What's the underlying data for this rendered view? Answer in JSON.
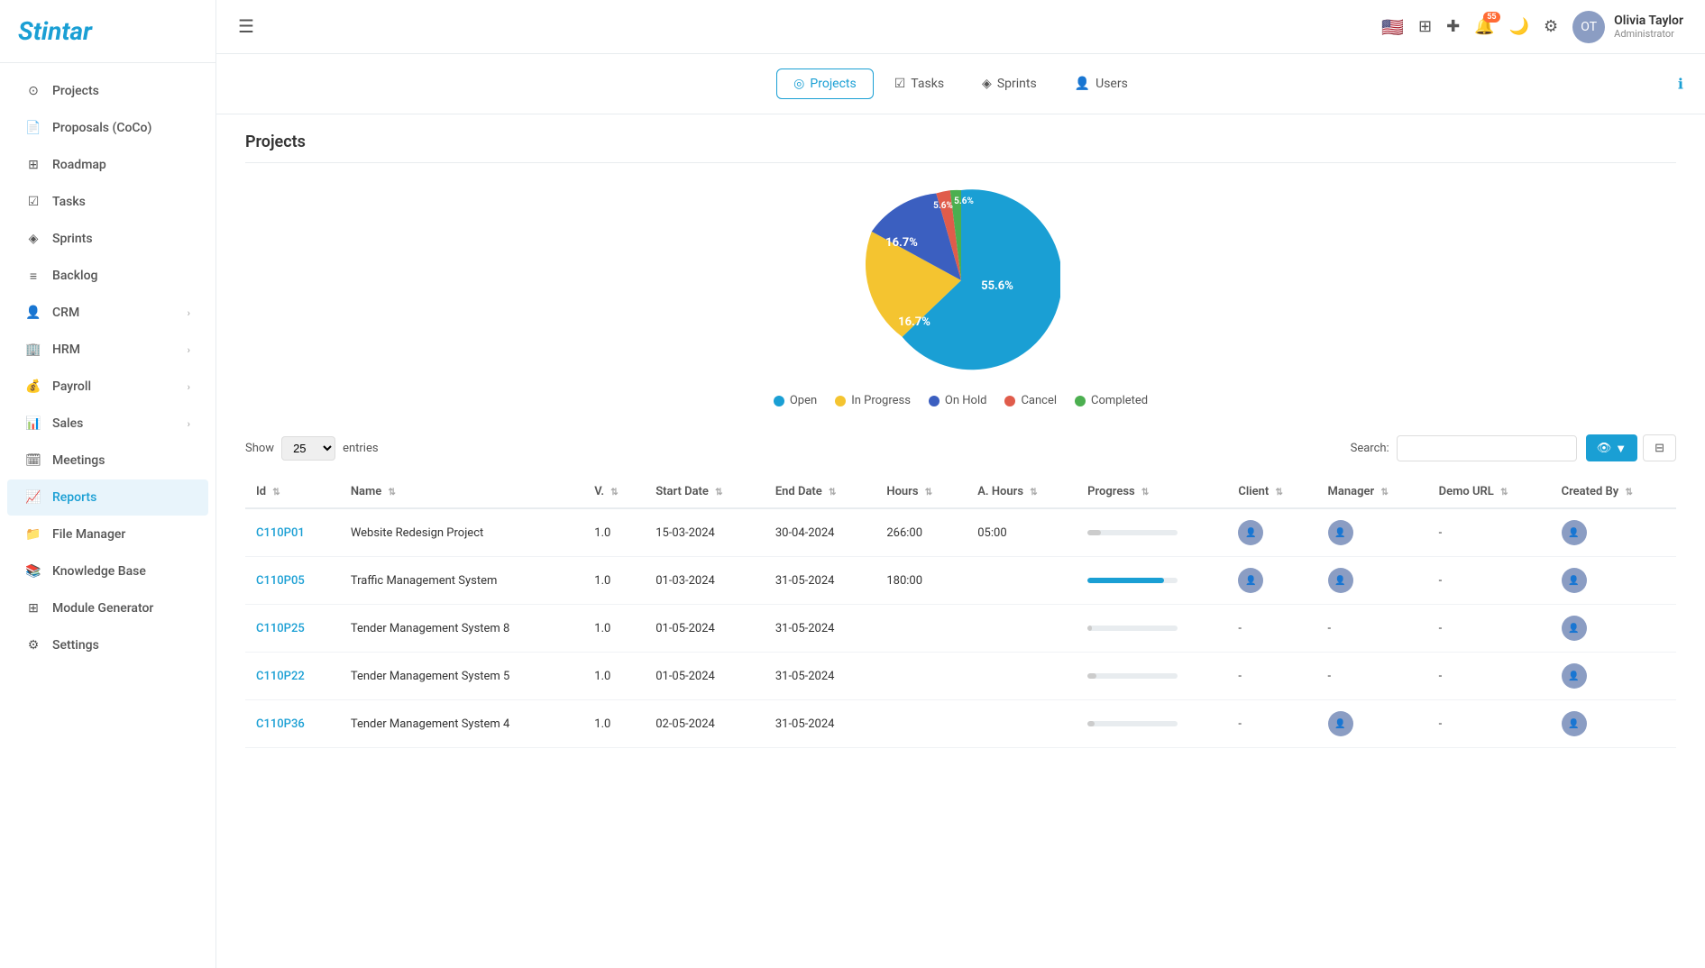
{
  "app": {
    "name": "Stintar",
    "logo_letter": "S"
  },
  "header": {
    "menu_icon": "☰",
    "notification_count": "55",
    "user": {
      "name": "Olivia Taylor",
      "role": "Administrator",
      "initials": "OT"
    }
  },
  "sidebar": {
    "items": [
      {
        "id": "projects",
        "label": "Projects",
        "icon": "◯",
        "active": false,
        "has_arrow": false
      },
      {
        "id": "proposals",
        "label": "Proposals (CoCo)",
        "icon": "📄",
        "active": false,
        "has_arrow": false
      },
      {
        "id": "roadmap",
        "label": "Roadmap",
        "icon": "⊞",
        "active": false,
        "has_arrow": false
      },
      {
        "id": "tasks",
        "label": "Tasks",
        "icon": "☑",
        "active": false,
        "has_arrow": false
      },
      {
        "id": "sprints",
        "label": "Sprints",
        "icon": "◈",
        "active": false,
        "has_arrow": false
      },
      {
        "id": "backlog",
        "label": "Backlog",
        "icon": "≡",
        "active": false,
        "has_arrow": false
      },
      {
        "id": "crm",
        "label": "CRM",
        "icon": "👤",
        "active": false,
        "has_arrow": true
      },
      {
        "id": "hrm",
        "label": "HRM",
        "icon": "🏢",
        "active": false,
        "has_arrow": true
      },
      {
        "id": "payroll",
        "label": "Payroll",
        "icon": "💰",
        "active": false,
        "has_arrow": true
      },
      {
        "id": "sales",
        "label": "Sales",
        "icon": "📊",
        "active": false,
        "has_arrow": true
      },
      {
        "id": "meetings",
        "label": "Meetings",
        "icon": "🗓",
        "active": false,
        "has_arrow": false
      },
      {
        "id": "reports",
        "label": "Reports",
        "icon": "📈",
        "active": true,
        "has_arrow": false
      },
      {
        "id": "file-manager",
        "label": "File Manager",
        "icon": "📁",
        "active": false,
        "has_arrow": false
      },
      {
        "id": "knowledge-base",
        "label": "Knowledge Base",
        "icon": "📚",
        "active": false,
        "has_arrow": false
      },
      {
        "id": "module-generator",
        "label": "Module Generator",
        "icon": "⊞",
        "active": false,
        "has_arrow": false
      },
      {
        "id": "settings",
        "label": "Settings",
        "icon": "⚙",
        "active": false,
        "has_arrow": false
      }
    ]
  },
  "tabs": [
    {
      "id": "projects",
      "label": "Projects",
      "icon": "◯",
      "active": true
    },
    {
      "id": "tasks",
      "label": "Tasks",
      "icon": "☑",
      "active": false
    },
    {
      "id": "sprints",
      "label": "Sprints",
      "icon": "◈",
      "active": false
    },
    {
      "id": "users",
      "label": "Users",
      "icon": "👤",
      "active": false
    }
  ],
  "page_title": "Projects",
  "chart": {
    "segments": [
      {
        "id": "open",
        "label": "Open",
        "value": 55.6,
        "color": "#1a9fd4",
        "text_color": "#fff"
      },
      {
        "id": "in-progress",
        "label": "In Progress",
        "value": 16.7,
        "color": "#f4c430",
        "text_color": "#fff"
      },
      {
        "id": "on-hold",
        "label": "On Hold",
        "value": 16.7,
        "color": "#3b5fc0",
        "text_color": "#fff"
      },
      {
        "id": "cancel",
        "label": "Cancel",
        "value": 5.6,
        "color": "#e05c4b",
        "text_color": "#fff"
      },
      {
        "id": "completed",
        "label": "Completed",
        "value": 5.6,
        "color": "#4caf50",
        "text_color": "#fff"
      }
    ]
  },
  "table": {
    "show_label": "Show",
    "entries_label": "entries",
    "search_label": "Search:",
    "show_count": "25",
    "columns": [
      {
        "id": "id",
        "label": "Id"
      },
      {
        "id": "name",
        "label": "Name"
      },
      {
        "id": "v",
        "label": "V."
      },
      {
        "id": "start_date",
        "label": "Start Date"
      },
      {
        "id": "end_date",
        "label": "End Date"
      },
      {
        "id": "hours",
        "label": "Hours"
      },
      {
        "id": "a_hours",
        "label": "A. Hours"
      },
      {
        "id": "progress",
        "label": "Progress"
      },
      {
        "id": "client",
        "label": "Client"
      },
      {
        "id": "manager",
        "label": "Manager"
      },
      {
        "id": "demo_url",
        "label": "Demo URL"
      },
      {
        "id": "created_by",
        "label": "Created By"
      }
    ],
    "rows": [
      {
        "id": "C110P01",
        "name": "Website Redesign Project",
        "v": "1.0",
        "start_date": "15-03-2024",
        "end_date": "30-04-2024",
        "hours": "266:00",
        "a_hours": "05:00",
        "progress": 15,
        "progress_color": "#ccc",
        "has_client": true,
        "has_manager": true,
        "has_created_by": true
      },
      {
        "id": "C110P05",
        "name": "Traffic Management System",
        "v": "1.0",
        "start_date": "01-03-2024",
        "end_date": "31-05-2024",
        "hours": "180:00",
        "a_hours": "",
        "progress": 85,
        "progress_color": "#1a9fd4",
        "has_client": true,
        "has_manager": true,
        "has_created_by": true
      },
      {
        "id": "C110P25",
        "name": "Tender Management System 8",
        "v": "1.0",
        "start_date": "01-05-2024",
        "end_date": "31-05-2024",
        "hours": "",
        "a_hours": "",
        "progress": 5,
        "progress_color": "#ccc",
        "has_client": false,
        "has_manager": false,
        "has_created_by": true
      },
      {
        "id": "C110P22",
        "name": "Tender Management System 5",
        "v": "1.0",
        "start_date": "01-05-2024",
        "end_date": "31-05-2024",
        "hours": "",
        "a_hours": "",
        "progress": 10,
        "progress_color": "#ccc",
        "has_client": false,
        "has_manager": false,
        "has_created_by": true
      },
      {
        "id": "C110P36",
        "name": "Tender Management System 4",
        "v": "1.0",
        "start_date": "02-05-2024",
        "end_date": "31-05-2024",
        "hours": "",
        "a_hours": "",
        "progress": 8,
        "progress_color": "#ccc",
        "has_client": false,
        "has_manager": true,
        "has_created_by": true
      }
    ]
  }
}
